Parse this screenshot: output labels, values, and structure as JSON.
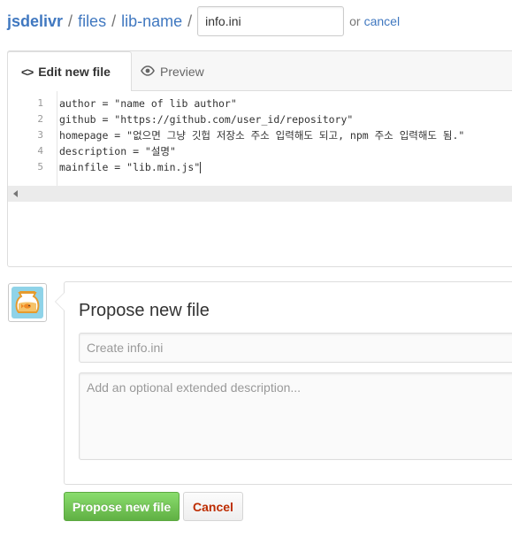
{
  "breadcrumb": {
    "repo": "jsdelivr",
    "separator": "/",
    "items": [
      "files",
      "lib-name"
    ],
    "filename_value": "info.ini",
    "or_text": "or",
    "cancel_link": "cancel"
  },
  "editor": {
    "tabs": [
      {
        "label": "Edit new file",
        "icon": "code-icon",
        "active": true
      },
      {
        "label": "Preview",
        "icon": "eye-icon",
        "active": false
      }
    ],
    "lines": [
      {
        "num": "1",
        "text": "author = \"name of lib author\""
      },
      {
        "num": "2",
        "text": "github = \"https://github.com/user_id/repository\""
      },
      {
        "num": "3",
        "text": "homepage = \"없으면 그냥 깃헙 저장소 주소 입력해도 되고, npm 주소 입력해도 됨.\""
      },
      {
        "num": "4",
        "text": "description = \"설명\""
      },
      {
        "num": "5",
        "text": "mainfile = \"lib.min.js\""
      }
    ]
  },
  "commit": {
    "avatar_icon": "fishbowl-avatar-icon",
    "title": "Propose new file",
    "summary_placeholder": "Create info.ini",
    "description_placeholder": "Add an optional extended description...",
    "propose_button": "Propose new file",
    "cancel_button": "Cancel"
  },
  "colors": {
    "link": "#4078c0",
    "propose_green": "#60b044",
    "cancel_red": "#bd2c00"
  }
}
